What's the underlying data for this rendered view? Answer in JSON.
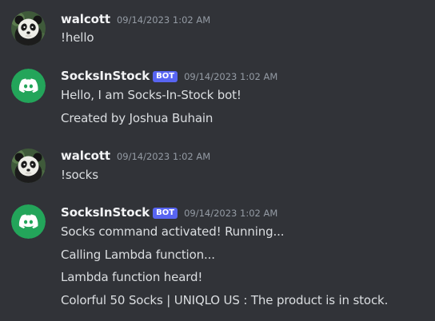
{
  "messages": [
    {
      "author": "walcott",
      "timestamp": "09/14/2023 1:02 AM",
      "avatar": "panda-avatar",
      "lines": [
        "!hello"
      ]
    },
    {
      "author": "SocksInStock",
      "badge": "BOT",
      "timestamp": "09/14/2023 1:02 AM",
      "avatar": "discord-bot-avatar",
      "lines": [
        "Hello, I am Socks-In-Stock bot!",
        "Created by Joshua Buhain"
      ]
    },
    {
      "author": "walcott",
      "timestamp": "09/14/2023 1:02 AM",
      "avatar": "panda-avatar",
      "lines": [
        "!socks"
      ]
    },
    {
      "author": "SocksInStock",
      "badge": "BOT",
      "timestamp": "09/14/2023 1:02 AM",
      "avatar": "discord-bot-avatar",
      "lines": [
        "Socks command activated! Running...",
        "Calling Lambda function...",
        "Lambda function heard!",
        "Colorful 50 Socks | UNIQLO US : The product is in stock."
      ]
    }
  ],
  "colors": {
    "background": "#313338",
    "bot_badge": "#5865f2",
    "bot_avatar": "#23a55a",
    "username": "#f2f3f5",
    "timestamp": "#949ba4",
    "text": "#dbdee1"
  }
}
